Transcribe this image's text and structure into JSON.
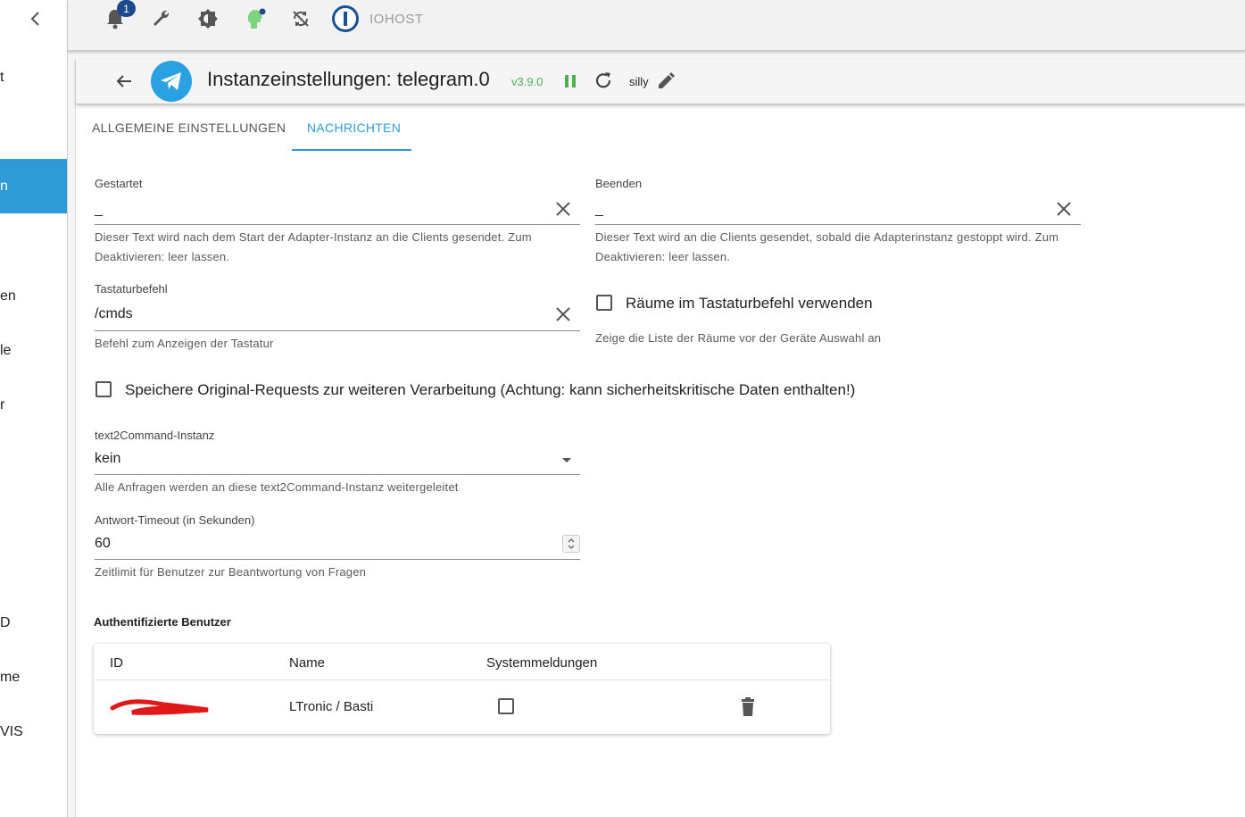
{
  "sidebar": {
    "items": [
      {
        "label": "t"
      },
      {
        "label": "n"
      },
      {
        "label": "en"
      },
      {
        "label": "le"
      },
      {
        "label": "r"
      },
      {
        "label": "D"
      },
      {
        "label": "me"
      },
      {
        "label": " VIS"
      }
    ]
  },
  "topbar": {
    "notification_count": "1",
    "host_label": "IOHOST"
  },
  "header": {
    "title": "Instanzeinstellungen: telegram.0",
    "version": "v3.9.0",
    "loglevel": "silly"
  },
  "tabs": [
    {
      "label": "ALLGEMEINE EINSTELLUNGEN"
    },
    {
      "label": "NACHRICHTEN"
    }
  ],
  "fields": {
    "gestartet": {
      "label": "Gestartet",
      "value": "_",
      "help1": "Dieser Text wird nach dem Start der Adapter-Instanz an die Clients gesendet. Zum",
      "help2": "Deaktivieren: leer lassen."
    },
    "beenden": {
      "label": "Beenden",
      "value": "_",
      "help1": "Dieser Text wird an die Clients gesendet, sobald die Adapterinstanz gestoppt wird. Zum",
      "help2": "Deaktivieren: leer lassen."
    },
    "tastatur": {
      "label": "Tastaturbefehl",
      "value": "/cmds",
      "help": "Befehl zum Anzeigen der Tastatur"
    },
    "raeume": {
      "label": "Räume im Tastaturbefehl verwenden",
      "help": "Zeige die Liste der Räume vor der Geräte Auswahl an"
    },
    "speichere": {
      "label": "Speichere Original-Requests zur weiteren Verarbeitung (Achtung: kann sicherheitskritische Daten enthalten!)"
    },
    "text2command": {
      "label": "text2Command-Instanz",
      "value": "kein",
      "help": "Alle Anfragen werden an diese text2Command-Instanz weitergeleitet"
    },
    "timeout": {
      "label": "Antwort-Timeout (in Sekunden)",
      "value": "60",
      "help": "Zeitlimit für Benutzer zur Beantwortung von Fragen"
    }
  },
  "users": {
    "title": "Authentifizierte Benutzer",
    "columns": [
      "ID",
      "Name",
      "Systemmeldungen"
    ],
    "rows": [
      {
        "name": "LTronic / Basti"
      }
    ]
  }
}
